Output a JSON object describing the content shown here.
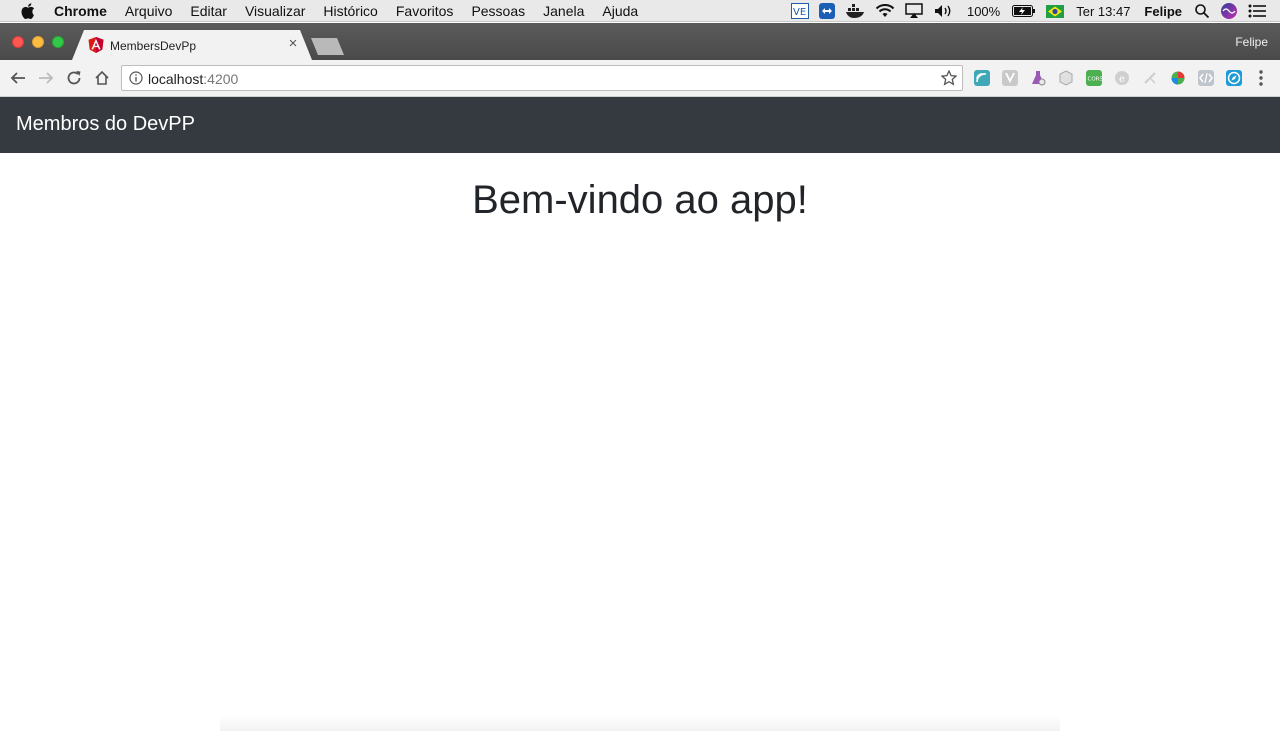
{
  "menubar": {
    "app_name": "Chrome",
    "items": [
      "Arquivo",
      "Editar",
      "Visualizar",
      "Histórico",
      "Favoritos",
      "Pessoas",
      "Janela",
      "Ajuda"
    ],
    "battery": "100%",
    "clock": "Ter 13:47",
    "user": "Felipe"
  },
  "browser": {
    "tab_title": "MembersDevPp",
    "profile_name": "Felipe",
    "url_host": "localhost",
    "url_port": ":4200"
  },
  "app": {
    "brand": "Membros do DevPP",
    "welcome": "Bem-vindo ao app!",
    "navbar_color": "#343a40"
  },
  "icons": {
    "tab_favicon": "angular-icon",
    "extensions": [
      "chromecast-icon",
      "vue-devtools-icon",
      "lab-flask-icon",
      "cube-icon",
      "cors-icon",
      "ember-icon",
      "puzzle-icon",
      "color-picker-icon",
      "code-icon",
      "compass-icon"
    ]
  }
}
